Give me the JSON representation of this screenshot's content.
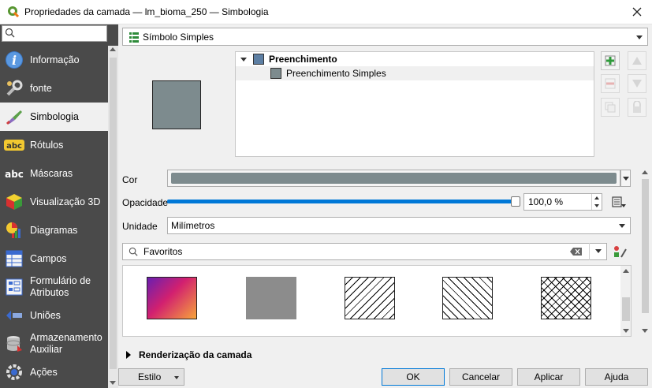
{
  "window": {
    "title": "Propriedades da camada — lm_bioma_250 — Simbologia"
  },
  "sidebar": {
    "search_placeholder": "",
    "items": [
      {
        "label": "Informação",
        "icon": "info-icon"
      },
      {
        "label": "fonte",
        "icon": "source-wrench-icon"
      },
      {
        "label": "Simbologia",
        "icon": "paintbrush-icon",
        "active": true
      },
      {
        "label": "Rótulos",
        "icon": "abc-label-icon"
      },
      {
        "label": "Máscaras",
        "icon": "abc-mask-icon"
      },
      {
        "label": "Visualização 3D",
        "icon": "cube-3d-icon"
      },
      {
        "label": "Diagramas",
        "icon": "diagram-icon"
      },
      {
        "label": "Campos",
        "icon": "fields-icon"
      },
      {
        "label": "Formulário de Atributos",
        "icon": "form-icon"
      },
      {
        "label": "Uniões",
        "icon": "joins-icon"
      },
      {
        "label": "Armazenamento Auxiliar",
        "icon": "storage-icon"
      },
      {
        "label": "Ações",
        "icon": "actions-gear-icon"
      }
    ]
  },
  "renderer": {
    "selected": "Símbolo Simples",
    "icon": "single-symbol-icon"
  },
  "symbol_tree": {
    "root": "Preenchimento",
    "child": "Preenchimento Simples",
    "root_color": "#5d7fa3",
    "child_color": "#7d8b8e"
  },
  "symbol_preview_color": "#7d8b8e",
  "properties": {
    "color_label": "Cor",
    "color_value": "#7d8b8e",
    "opacity_label": "Opacidade",
    "opacity_value": "100,0 %",
    "opacity_fraction": 1.0,
    "unit_label": "Unidade",
    "unit_value": "Milímetros"
  },
  "favorites": {
    "search_value": "Favoritos"
  },
  "gallery": {
    "items": [
      {
        "caption": "...",
        "kind": "gradient"
      },
      {
        "caption": "...",
        "kind": "solid"
      },
      {
        "caption": "...",
        "kind": "hatch-forward"
      },
      {
        "caption": "...",
        "kind": "hatch-back"
      },
      {
        "caption": "...",
        "kind": "hatch-cross"
      }
    ]
  },
  "layer_rendering": {
    "label": "Renderização da camada"
  },
  "buttons": {
    "style": "Estilo",
    "ok": "OK",
    "cancel": "Cancelar",
    "apply": "Aplicar",
    "help": "Ajuda"
  },
  "colors": {
    "sidebar_bg": "#4a4a4a",
    "accent": "#0078d7"
  }
}
